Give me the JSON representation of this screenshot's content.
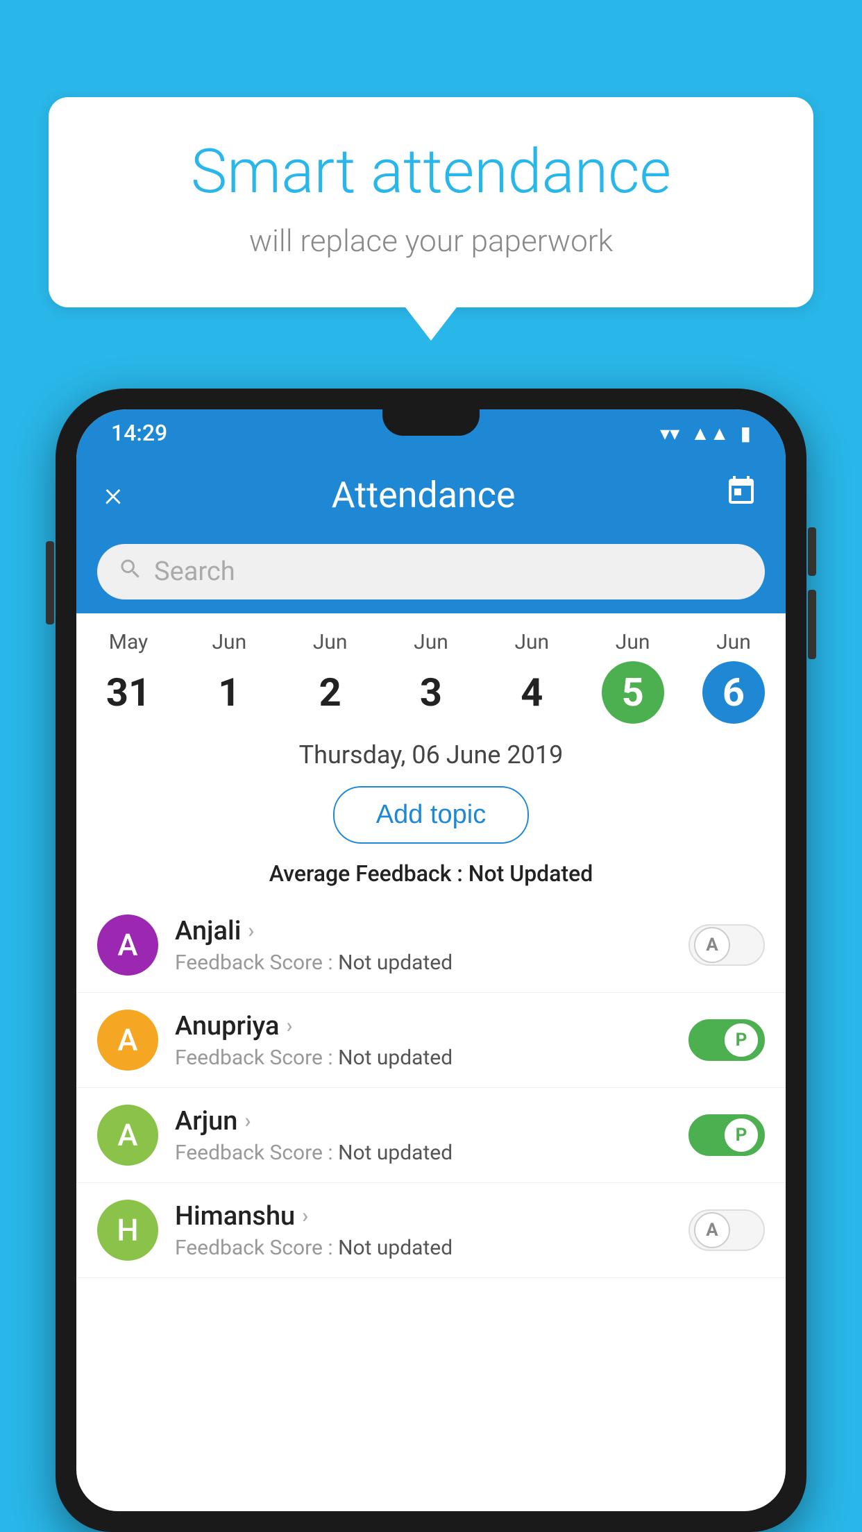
{
  "background_color": "#29b6e8",
  "speech_bubble": {
    "title": "Smart attendance",
    "subtitle": "will replace your paperwork"
  },
  "status_bar": {
    "time": "14:29",
    "icons": [
      "wifi",
      "signal",
      "battery"
    ]
  },
  "header": {
    "close_label": "×",
    "title": "Attendance",
    "calendar_icon": "📅"
  },
  "search": {
    "placeholder": "Search"
  },
  "calendar": {
    "days": [
      {
        "month": "May",
        "date": "31",
        "state": "normal"
      },
      {
        "month": "Jun",
        "date": "1",
        "state": "normal"
      },
      {
        "month": "Jun",
        "date": "2",
        "state": "normal"
      },
      {
        "month": "Jun",
        "date": "3",
        "state": "normal"
      },
      {
        "month": "Jun",
        "date": "4",
        "state": "normal"
      },
      {
        "month": "Jun",
        "date": "5",
        "state": "today"
      },
      {
        "month": "Jun",
        "date": "6",
        "state": "selected"
      }
    ]
  },
  "selected_date_label": "Thursday, 06 June 2019",
  "add_topic_label": "Add topic",
  "average_feedback": {
    "label": "Average Feedback : ",
    "value": "Not Updated"
  },
  "students": [
    {
      "name": "Anjali",
      "avatar_letter": "A",
      "avatar_color": "#9c27b0",
      "feedback_label": "Feedback Score : ",
      "feedback_value": "Not updated",
      "toggle_state": "off",
      "toggle_label": "A"
    },
    {
      "name": "Anupriya",
      "avatar_letter": "A",
      "avatar_color": "#f5a623",
      "feedback_label": "Feedback Score : ",
      "feedback_value": "Not updated",
      "toggle_state": "on",
      "toggle_label": "P"
    },
    {
      "name": "Arjun",
      "avatar_letter": "A",
      "avatar_color": "#8bc34a",
      "feedback_label": "Feedback Score : ",
      "feedback_value": "Not updated",
      "toggle_state": "on",
      "toggle_label": "P"
    },
    {
      "name": "Himanshu",
      "avatar_letter": "H",
      "avatar_color": "#8bc34a",
      "feedback_label": "Feedback Score : ",
      "feedback_value": "Not updated",
      "toggle_state": "off",
      "toggle_label": "A"
    }
  ]
}
